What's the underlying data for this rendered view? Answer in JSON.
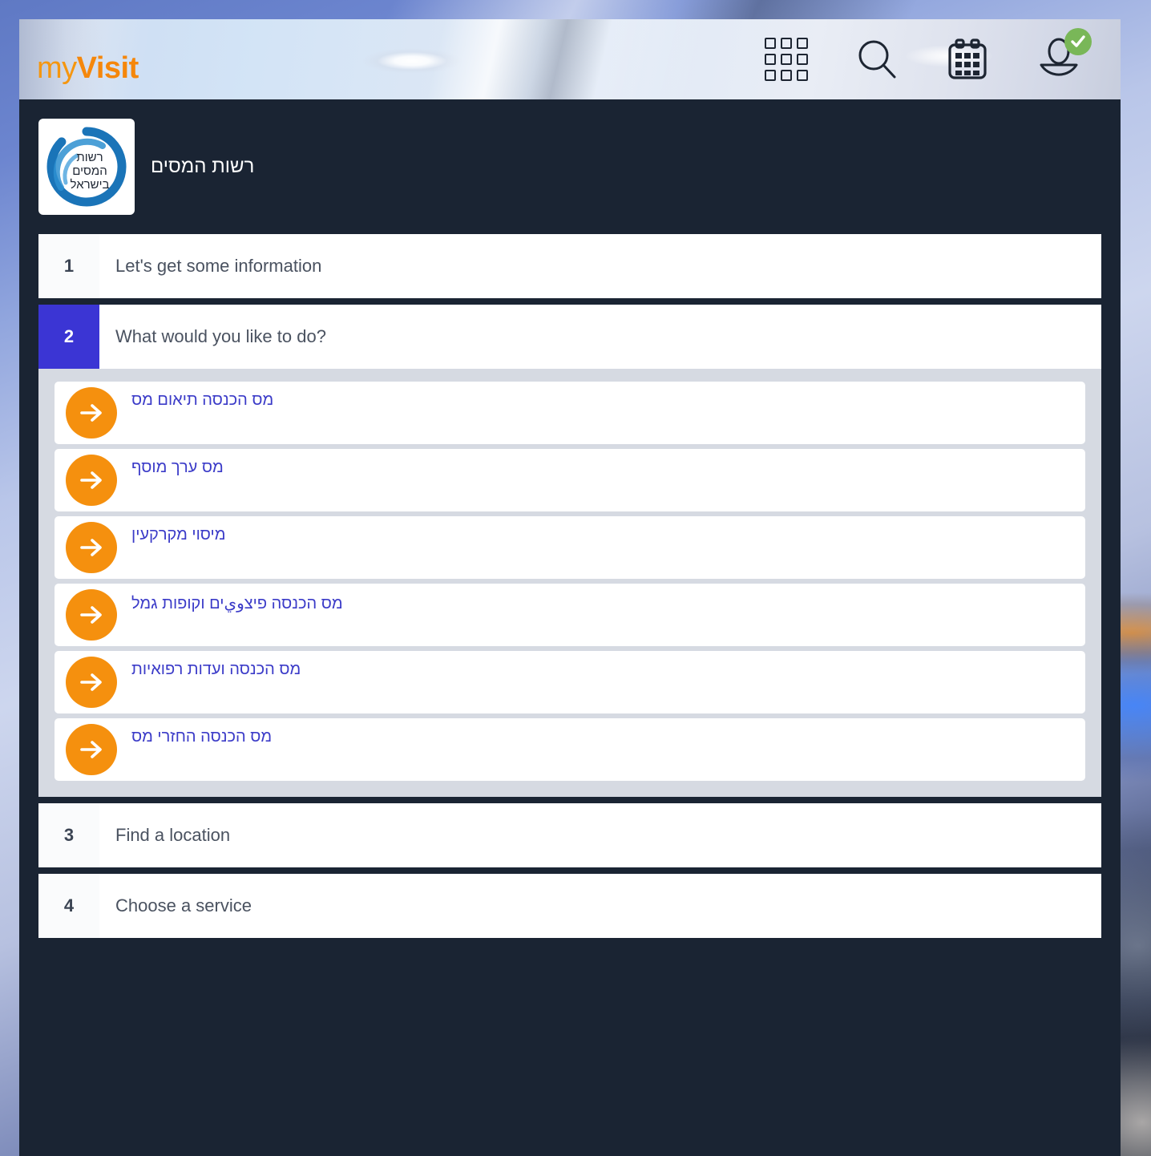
{
  "brand": {
    "logo_prefix": "my",
    "logo_suffix": "Visit"
  },
  "header": {
    "icons": [
      {
        "name": "apps-grid-icon",
        "label": "apps"
      },
      {
        "name": "search-icon",
        "label": "search"
      },
      {
        "name": "calendar-icon",
        "label": "calendar"
      },
      {
        "name": "user-avatar-icon",
        "label": "account"
      }
    ],
    "account_status": "verified"
  },
  "organization": {
    "name": "רשות המסים",
    "logo_text_line1": "רשות",
    "logo_text_line2": "המסים",
    "logo_text_line3": "בישראל",
    "logo_color": "#1a74b8"
  },
  "steps": [
    {
      "number": "1",
      "title": "Let's get some information",
      "state": "collapsed"
    },
    {
      "number": "2",
      "title": "What would you like to do?",
      "state": "active"
    },
    {
      "number": "3",
      "title": "Find a location",
      "state": "collapsed"
    },
    {
      "number": "4",
      "title": "Choose a service",
      "state": "collapsed"
    }
  ],
  "services": [
    {
      "label": "מס הכנסה תיאום מס"
    },
    {
      "label": "מס ערך מוסף"
    },
    {
      "label": "מיסוי מקרקעין"
    },
    {
      "label": "מס הכנסה פיצويים וקופות גמל"
    },
    {
      "label": "מס הכנסה ועדות רפואיות"
    },
    {
      "label": "מס הכנסה החזרי מס"
    }
  ],
  "colors": {
    "accent_orange": "#F5900E",
    "active_step_blue": "#3b35d4",
    "link_blue": "#3b3bc8",
    "app_background": "#1a2433",
    "panel_background": "#d6dae2",
    "badge_green": "#79b758"
  }
}
